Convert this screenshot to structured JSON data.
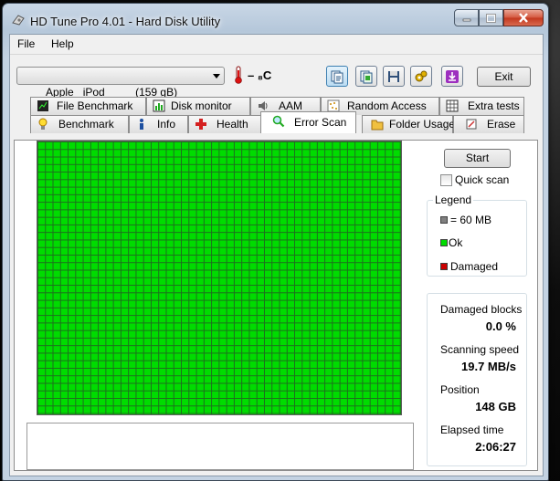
{
  "window": {
    "title": "HD Tune Pro 4.01 - Hard Disk Utility"
  },
  "menu": [
    {
      "label": "File"
    },
    {
      "label": "Help"
    }
  ],
  "toolbar": {
    "drive": "Apple   iPod          (159 gB)",
    "temperature": "– ₈C",
    "exit_label": "Exit",
    "buttons": [
      {
        "icon": "copy-text-icon"
      },
      {
        "icon": "copy-image-icon"
      },
      {
        "icon": "save-icon"
      },
      {
        "icon": "options-icon"
      },
      {
        "icon": "download-icon"
      }
    ]
  },
  "tabs_row1": [
    {
      "label": "File Benchmark",
      "icon": "file-benchmark-icon"
    },
    {
      "label": "Disk monitor",
      "icon": "disk-monitor-icon"
    },
    {
      "label": "AAM",
      "icon": "speaker-icon"
    },
    {
      "label": "Random Access",
      "icon": "random-access-icon"
    },
    {
      "label": "Extra tests",
      "icon": "extra-tests-icon"
    }
  ],
  "tabs_row2": [
    {
      "label": "Benchmark",
      "icon": "benchmark-icon"
    },
    {
      "label": "Info",
      "icon": "info-icon"
    },
    {
      "label": "Health",
      "icon": "health-cross-icon"
    },
    {
      "label": "Error Scan",
      "icon": "magnifier-icon",
      "active": true
    },
    {
      "label": "Folder Usage",
      "icon": "folder-icon"
    },
    {
      "label": "Erase",
      "icon": "erase-icon"
    }
  ],
  "scan": {
    "start_label": "Start",
    "quick_scan_label": "Quick scan",
    "quick_scan_checked": false,
    "block_status": "all-ok",
    "colors": {
      "ok": "#00dc00",
      "damaged": "#cc0000",
      "block": "#808080"
    }
  },
  "legend": {
    "title": "Legend",
    "items": [
      {
        "label": "= 60 MB",
        "color": "#808080"
      },
      {
        "label": "Ok",
        "color": "#00dc00"
      },
      {
        "label": "Damaged",
        "color": "#cc0000"
      }
    ]
  },
  "stats": {
    "damaged_blocks_label": "Damaged blocks",
    "damaged_blocks_value": "0.0 %",
    "scanning_speed_label": "Scanning speed",
    "scanning_speed_value": "19.7 MB/s",
    "position_label": "Position",
    "position_value": "148 GB",
    "elapsed_label": "Elapsed time",
    "elapsed_value": "2:06:27"
  }
}
